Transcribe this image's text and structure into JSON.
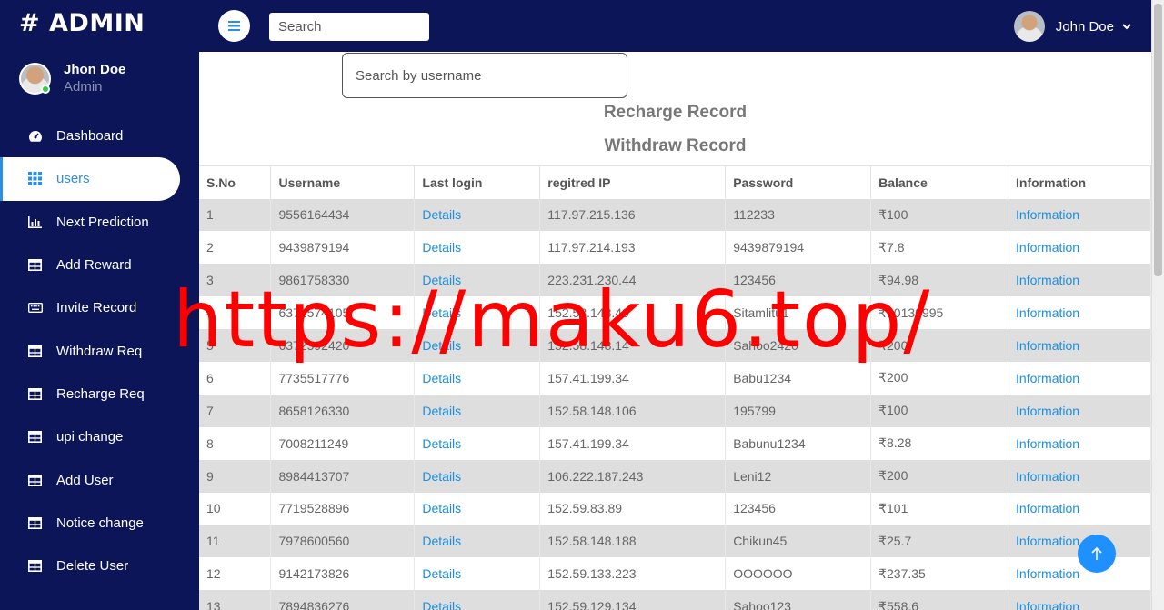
{
  "brand": "# ADMIN",
  "profile": {
    "name": "Jhon Doe",
    "role": "Admin"
  },
  "nav": [
    {
      "label": "Dashboard",
      "icon": "dashboard-gauge-icon"
    },
    {
      "label": "users",
      "icon": "grid-icon",
      "active": true
    },
    {
      "label": "Next Prediction",
      "icon": "bar-chart-icon"
    },
    {
      "label": "Add Reward",
      "icon": "table-icon"
    },
    {
      "label": "Invite Record",
      "icon": "keyboard-icon"
    },
    {
      "label": "Withdraw Req",
      "icon": "table-icon"
    },
    {
      "label": "Recharge Req",
      "icon": "table-icon"
    },
    {
      "label": "upi change",
      "icon": "table-icon"
    },
    {
      "label": "Add User",
      "icon": "table-icon"
    },
    {
      "label": "Notice change",
      "icon": "table-icon"
    },
    {
      "label": "Delete User",
      "icon": "table-icon"
    }
  ],
  "topbar": {
    "search_placeholder": "Search",
    "user_name": "John Doe"
  },
  "main": {
    "search_placeholder": "Search by username",
    "recharge_record": "Recharge Record",
    "withdraw_record": "Withdraw Record"
  },
  "table": {
    "headers": [
      "S.No",
      "Username",
      "Last login",
      "regitred IP",
      "Password",
      "Balance",
      "Information"
    ],
    "rows": [
      [
        "1",
        "9556164434",
        "Details",
        "117.97.215.136",
        "112233",
        "₹100",
        "Information"
      ],
      [
        "2",
        "9439879194",
        "Details",
        "117.97.214.193",
        "9439879194",
        "₹7.8",
        "Information"
      ],
      [
        "3",
        "9861758330",
        "Details",
        "223.231.230.44",
        "123456",
        "₹94.98",
        "Information"
      ],
      [
        "4",
        "6372574105",
        "Details",
        "152.58.148.40",
        "Sitamlitu1",
        "₹10130995",
        "Information"
      ],
      [
        "5",
        "6372592420",
        "Details",
        "152.58.148.14",
        "Sahoo2420",
        "₹200",
        "Information"
      ],
      [
        "6",
        "7735517776",
        "Details",
        "157.41.199.34",
        "Babu1234",
        "₹200",
        "Information"
      ],
      [
        "7",
        "8658126330",
        "Details",
        "152.58.148.106",
        "195799",
        "₹100",
        "Information"
      ],
      [
        "8",
        "7008211249",
        "Details",
        "157.41.199.34",
        "Babunu1234",
        "₹8.28",
        "Information"
      ],
      [
        "9",
        "8984413707",
        "Details",
        "106.222.187.243",
        "Leni12",
        "₹200",
        "Information"
      ],
      [
        "10",
        "7719528896",
        "Details",
        "152.59.83.89",
        "123456",
        "₹101",
        "Information"
      ],
      [
        "11",
        "7978600560",
        "Details",
        "152.58.148.188",
        "Chikun45",
        "₹25.7",
        "Information"
      ],
      [
        "12",
        "9142173826",
        "Details",
        "152.59.133.223",
        "OOOOOO",
        "₹237.35",
        "Information"
      ],
      [
        "13",
        "7894836276",
        "Details",
        "152.59.129.134",
        "Sahoo123",
        "₹558.6",
        "Information"
      ]
    ]
  },
  "watermark": "https://maku6.top/",
  "colors": {
    "navy": "#0b1557",
    "accent": "#2c8fe6",
    "link": "#1a8fe0",
    "watermark": "#ff0000"
  }
}
